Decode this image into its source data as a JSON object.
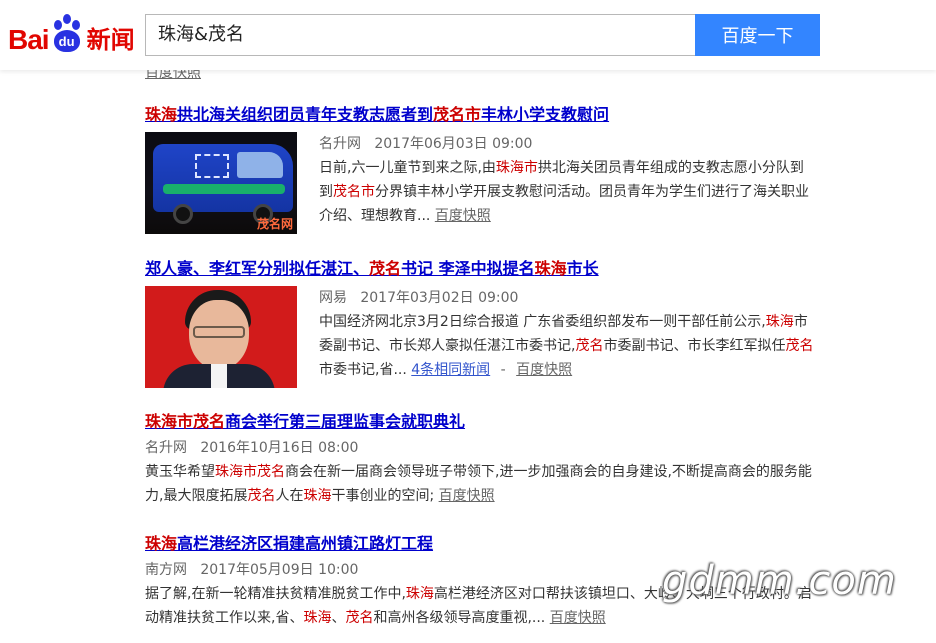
{
  "header": {
    "logo": {
      "bai": "Bai",
      "du": "du",
      "news": "新闻"
    },
    "search_value": "珠海&茂名",
    "search_button": "百度一下"
  },
  "peek_text": "百度快照",
  "results": [
    {
      "title": [
        {
          "t": "珠海",
          "hl": true
        },
        {
          "t": "拱北海关组织团员青年支教志愿者到",
          "hl": false
        },
        {
          "t": "茂名市",
          "hl": true
        },
        {
          "t": "丰林小学支教慰问",
          "hl": false
        }
      ],
      "source": "名升网",
      "date": "2017年06月03日  09:00",
      "summary": [
        {
          "t": "日前,六一儿童节到来之际,由",
          "hl": false
        },
        {
          "t": "珠海市",
          "hl": true
        },
        {
          "t": "拱北海关团员青年组成的支教志愿小分队到到",
          "hl": false
        },
        {
          "t": "茂名市",
          "hl": true
        },
        {
          "t": "分界镇丰林小学开展支教慰问活动。团员青年为学生们进行了海关职业介绍、理想教育...",
          "hl": false
        }
      ],
      "snapshot": "百度快照",
      "thumb_mark": "茂名网"
    },
    {
      "title": [
        {
          "t": "郑人豪、李红军分别拟任湛江、",
          "hl": false
        },
        {
          "t": "茂名",
          "hl": true
        },
        {
          "t": "书记 李泽中拟提名",
          "hl": false
        },
        {
          "t": "珠海",
          "hl": true
        },
        {
          "t": "市长",
          "hl": false
        }
      ],
      "source": "网易",
      "date": "2017年03月02日  09:00",
      "summary": [
        {
          "t": "中国经济网北京3月2日综合报道 广东省委组织部发布一则干部任前公示,",
          "hl": false
        },
        {
          "t": "珠海",
          "hl": true
        },
        {
          "t": "市委副书记、市长郑人豪拟任湛江市委书记,",
          "hl": false
        },
        {
          "t": "茂名",
          "hl": true
        },
        {
          "t": "市委副书记、市长李红军拟任",
          "hl": false
        },
        {
          "t": "茂名",
          "hl": true
        },
        {
          "t": "市委书记,省...",
          "hl": false
        }
      ],
      "related": "4条相同新闻",
      "separator": "-",
      "snapshot": "百度快照"
    },
    {
      "title": [
        {
          "t": "珠海市茂名",
          "hl": true
        },
        {
          "t": "商会举行第三届理监事会就职典礼",
          "hl": false
        }
      ],
      "source": "名升网",
      "date": "2016年10月16日  08:00",
      "summary": [
        {
          "t": "黄玉华希望",
          "hl": false
        },
        {
          "t": "珠海市茂名",
          "hl": true
        },
        {
          "t": "商会在新一届商会领导班子带领下,进一步加强商会的自身建设,不断提高商会的服务能力,最大限度拓展",
          "hl": false
        },
        {
          "t": "茂名",
          "hl": true
        },
        {
          "t": "人在",
          "hl": false
        },
        {
          "t": "珠海",
          "hl": true
        },
        {
          "t": "干事创业的空间;",
          "hl": false
        }
      ],
      "snapshot": "百度快照"
    },
    {
      "title": [
        {
          "t": "珠海",
          "hl": true
        },
        {
          "t": "高栏港经济区捐建高州镇江路灯工程",
          "hl": false
        }
      ],
      "source": "南方网",
      "date": "2017年05月09日  10:00",
      "summary": [
        {
          "t": "据了解,在新一轮精准扶贫精准脱贫工作中,",
          "hl": false
        },
        {
          "t": "珠海",
          "hl": true
        },
        {
          "t": "高栏港经济区对口帮扶该镇坦口、大岭、大垌三个行政村。启动精准扶贫工作以来,省、",
          "hl": false
        },
        {
          "t": "珠海",
          "hl": true
        },
        {
          "t": "、",
          "hl": false
        },
        {
          "t": "茂名",
          "hl": true
        },
        {
          "t": "和高州各级领导高度重视,...",
          "hl": false
        }
      ],
      "snapshot": "百度快照"
    }
  ],
  "watermark": "gdmm.com"
}
